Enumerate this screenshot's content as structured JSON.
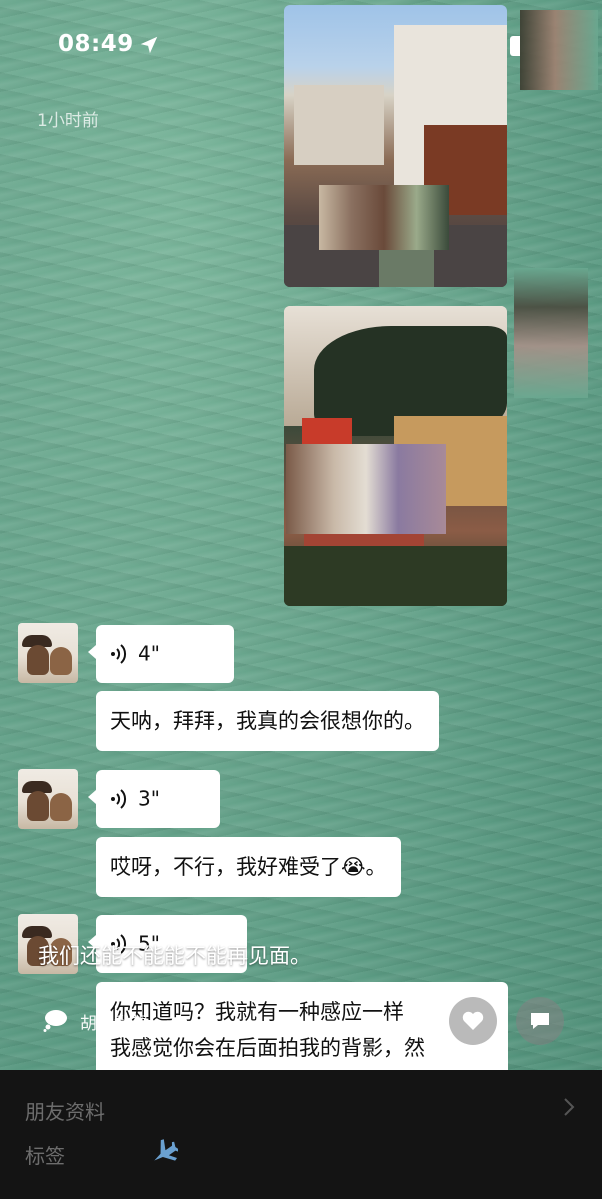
{
  "status_bar": {
    "time": "08:49"
  },
  "timestamp": "1小时前",
  "messages": [
    {
      "kind": "voice",
      "duration": "4\""
    },
    {
      "kind": "text",
      "text": "天呐，拜拜，我真的会很想你的。"
    },
    {
      "kind": "voice",
      "duration": "3\""
    },
    {
      "kind": "text",
      "text": "哎呀，不行，我好难受了😭。"
    },
    {
      "kind": "voice",
      "duration": "5\""
    },
    {
      "kind": "text",
      "lines": [
        "你知道吗？我就有一种感应一样",
        "我感觉你会在后面拍我的背影，然"
      ]
    }
  ],
  "caption": "我们还能不能能不能再见面。",
  "mood_status": "胡思乱想",
  "profile": {
    "friend_info": "朋友资料",
    "tags_label": "标签"
  },
  "icons": [
    "location-arrow-icon",
    "signal-icon",
    "wifi-icon",
    "battery-icon",
    "voice-wave-icon",
    "thought-bubble-icon",
    "heart-icon",
    "comment-icon",
    "chevron-right-icon",
    "airplane-icon"
  ],
  "colors": {
    "bubble": "#ffffff",
    "bottom_panel": "#141414",
    "water_green": "#5f9e86"
  }
}
